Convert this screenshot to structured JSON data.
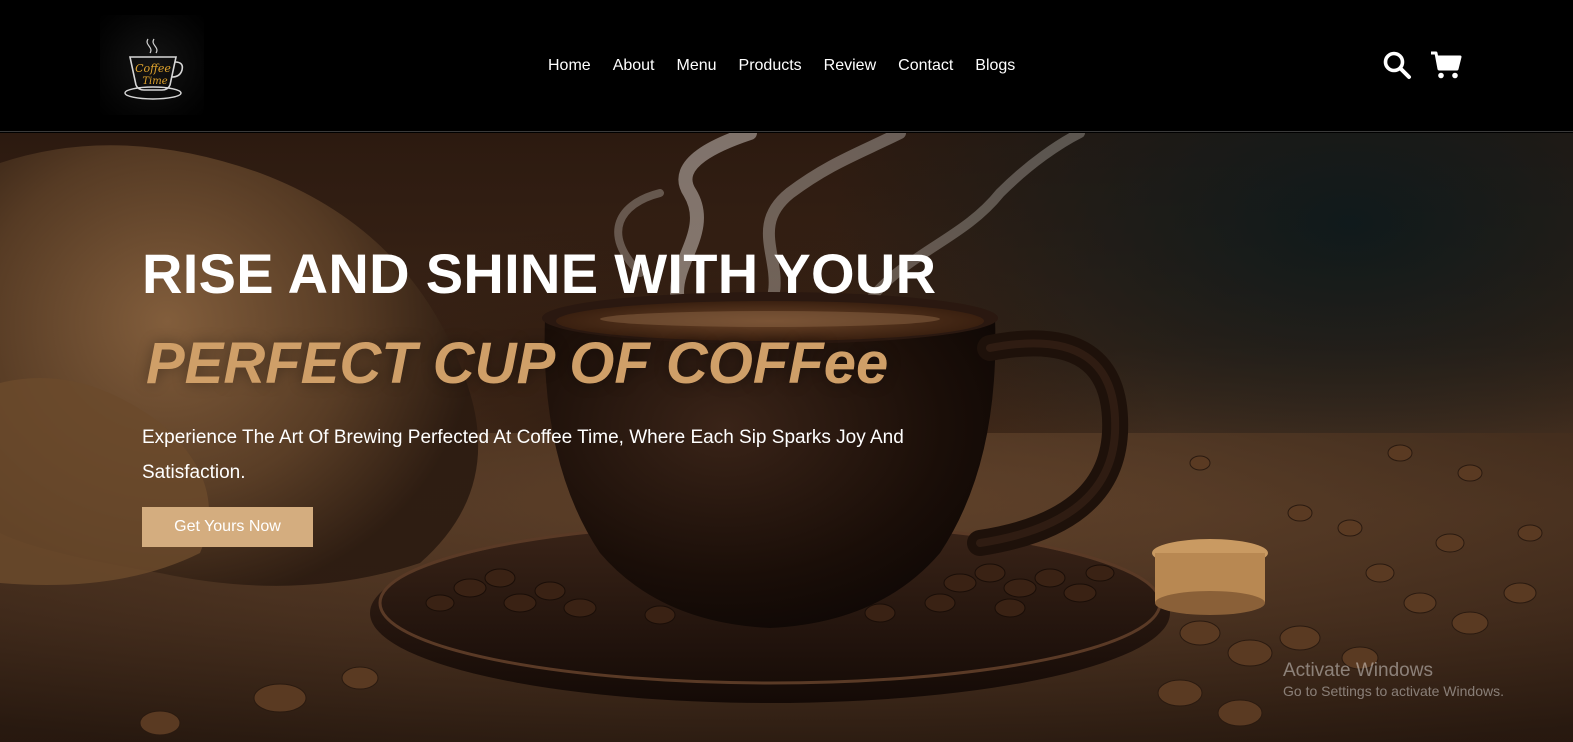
{
  "logo": {
    "text_line1": "Coffee",
    "text_line2": "Time",
    "icon": "coffee-cup-logo"
  },
  "nav": {
    "items": [
      {
        "label": "Home"
      },
      {
        "label": "About"
      },
      {
        "label": "Menu"
      },
      {
        "label": "Products"
      },
      {
        "label": "Review"
      },
      {
        "label": "Contact"
      },
      {
        "label": "Blogs"
      }
    ]
  },
  "header_icons": {
    "search": "search-icon",
    "cart": "cart-icon"
  },
  "hero": {
    "title": "RISE AND SHINE WITH YOUR",
    "subtitle": "PERFECT CUP OF COFFee",
    "description": "Experience The Art Of Brewing Perfected At Coffee Time, Where Each Sip Sparks Joy And Satisfaction.",
    "cta_label": "Get Yours Now",
    "background": "coffee-cup-with-beans-image"
  },
  "watermark": {
    "title": "Activate Windows",
    "subtitle": "Go to Settings to activate Windows."
  },
  "colors": {
    "header_bg": "#000000",
    "accent": "#cf9f68",
    "button_bg": "#d4ad7f",
    "text": "#ffffff"
  }
}
